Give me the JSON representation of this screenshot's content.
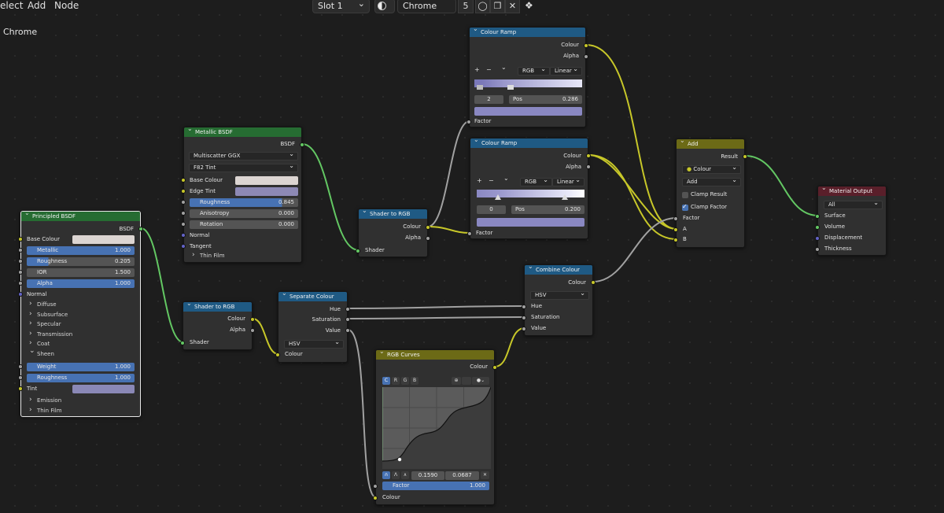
{
  "header": {
    "menu": [
      "elect",
      "Add",
      "Node"
    ],
    "slot": "Slot 1",
    "material_name": "Chrome",
    "user_count": "5",
    "material_label": "Chrome"
  },
  "icons": [
    "material-sphere-icon",
    "fake-user-shield-icon",
    "duplicate-icon",
    "close-icon",
    "pin-icon",
    "zoom-icon",
    "curve-preset-icon"
  ],
  "nodes": {
    "principled": {
      "title": "Principled BSDF",
      "out": "BSDF",
      "base_colour": "Base Colour",
      "metallic": "Metallic",
      "metallic_val": "1.000",
      "roughness": "Roughness",
      "roughness_val": "0.205",
      "ior": "IOR",
      "ior_val": "1.500",
      "alpha": "Alpha",
      "alpha_val": "1.000",
      "normal": "Normal",
      "panels": [
        "Diffuse",
        "Subsurface",
        "Specular",
        "Transmission",
        "Coat"
      ],
      "sheen": "Sheen",
      "weight": "Weight",
      "weight_val": "1.000",
      "sheen_roughness": "Roughness",
      "sheen_roughness_val": "1.000",
      "tint": "Tint",
      "emission": "Emission",
      "thin_film": "Thin Film"
    },
    "metallic": {
      "title": "Metallic BSDF",
      "out": "BSDF",
      "distribution": "Multiscatter GGX",
      "fresnel": "F82 Tint",
      "base_colour": "Base Colour",
      "edge_tint": "Edge Tint",
      "roughness": "Roughness",
      "roughness_val": "0.845",
      "anisotropy": "Anisotropy",
      "anisotropy_val": "0.000",
      "rotation": "Rotation",
      "rotation_val": "0.000",
      "normal": "Normal",
      "tangent": "Tangent",
      "thin_film": "Thin Film"
    },
    "shader_rgb_1": {
      "title": "Shader to RGB",
      "colour": "Colour",
      "alpha": "Alpha",
      "shader": "Shader"
    },
    "shader_rgb_2": {
      "title": "Shader to RGB",
      "colour": "Colour",
      "alpha": "Alpha",
      "shader": "Shader"
    },
    "separate": {
      "title": "Separate Colour",
      "hue": "Hue",
      "saturation": "Saturation",
      "value": "Value",
      "mode": "HSV",
      "colour": "Colour"
    },
    "ramp1": {
      "title": "Colour Ramp",
      "colour": "Colour",
      "alpha": "Alpha",
      "mode": "RGB",
      "interp": "Linear",
      "index": "2",
      "pos_label": "Pos",
      "pos_val": "0.286",
      "factor": "Factor"
    },
    "ramp2": {
      "title": "Colour Ramp",
      "colour": "Colour",
      "alpha": "Alpha",
      "mode": "RGB",
      "interp": "Linear",
      "index": "0",
      "pos_label": "Pos",
      "pos_val": "0.200",
      "factor": "Factor"
    },
    "combine": {
      "title": "Combine Colour",
      "colour": "Colour",
      "mode": "HSV",
      "hue": "Hue",
      "saturation": "Saturation",
      "value": "Value"
    },
    "curves": {
      "title": "RGB Curves",
      "colour_out": "Colour",
      "tabs": [
        "C",
        "R",
        "G",
        "B"
      ],
      "x_val": "0.1590",
      "y_val": "0.0687",
      "factor": "Factor",
      "factor_val": "1.000",
      "colour_in": "Colour"
    },
    "mix": {
      "title": "Add",
      "result": "Result",
      "data_type": "Colour",
      "blend": "Add",
      "clamp_result": "Clamp Result",
      "clamp_factor": "Clamp Factor",
      "factor": "Factor",
      "a": "A",
      "b": "B"
    },
    "output": {
      "title": "Material Output",
      "target": "All",
      "surface": "Surface",
      "volume": "Volume",
      "displacement": "Displacement",
      "thickness": "Thickness"
    }
  },
  "colors": {
    "shader_header": "#266c32",
    "converter_header": "#1f5a84",
    "color_header": "#6c6a16",
    "output_header": "#5a1f2a",
    "socket_colour": "#c7c729",
    "socket_float": "#a1a1a1",
    "socket_shader": "#63c763",
    "socket_vector": "#6363c7",
    "accent": "#4772b3",
    "base_colour_swatch": "#dcd5d2",
    "edge_tint_swatch": "#8d89b5",
    "sheen_tint_swatch": "#8a88b6",
    "ramp_colour": "#8a88c2"
  }
}
